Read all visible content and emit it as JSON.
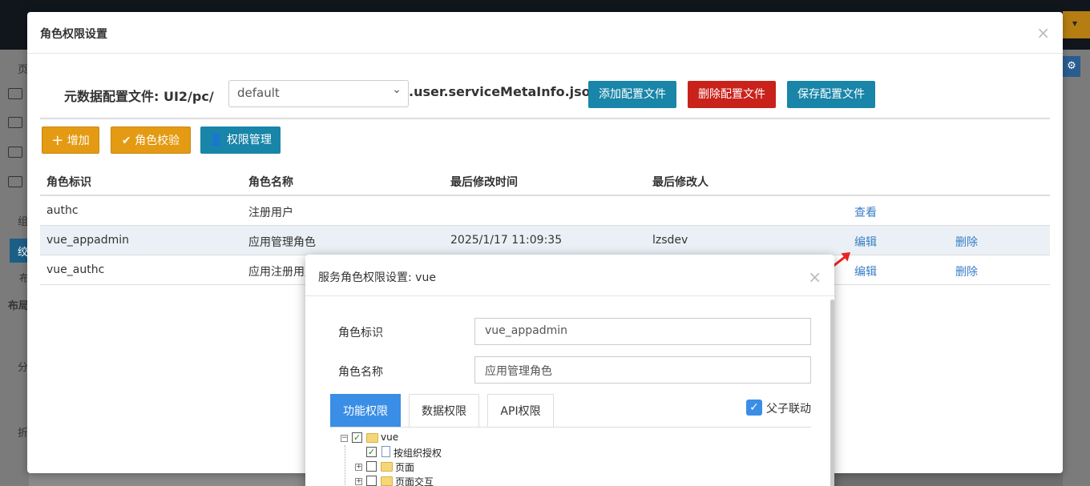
{
  "background": {
    "left_texts": [
      "页",
      "组",
      "绞",
      "布",
      "布局",
      "分",
      "折"
    ]
  },
  "dialog": {
    "title": "角色权限设置",
    "close": "×",
    "config": {
      "label": "元数据配置文件:  UI2/pc/",
      "selected": "default",
      "suffix": ".user.serviceMetaInfo.json",
      "add_btn": "添加配置文件",
      "delete_btn": "删除配置文件",
      "save_btn": "保存配置文件"
    },
    "toolbar": {
      "add": "增加",
      "check": "角色校验",
      "perm": "权限管理"
    },
    "table": {
      "headers": [
        "角色标识",
        "角色名称",
        "最后修改时间",
        "最后修改人"
      ],
      "rows": [
        {
          "id": "authc",
          "name": "注册用户",
          "time": "",
          "user": "",
          "action1": "查看",
          "action2": ""
        },
        {
          "id": "vue_appadmin",
          "name": "应用管理角色",
          "time": "2025/1/17 11:09:35",
          "user": "lzsdev",
          "action1": "编辑",
          "action2": "删除"
        },
        {
          "id": "vue_authc",
          "name": "应用注册用户",
          "time": "",
          "user": "",
          "action1": "编辑",
          "action2": "删除"
        }
      ]
    }
  },
  "subdialog": {
    "title": "服务角色权限设置:  vue",
    "close": "×",
    "role_id_label": "角色标识",
    "role_id_value": "vue_appadmin",
    "role_name_label": "角色名称",
    "role_name_value": "应用管理角色",
    "tabs": [
      "功能权限",
      "数据权限",
      "API权限"
    ],
    "link_label": "父子联动",
    "tree": {
      "root": "vue",
      "items": [
        "按组织授权",
        "页面",
        "页面交互"
      ]
    }
  },
  "colors": {
    "primary": "#1985a8",
    "danger": "#c9221b",
    "warning": "#e49a12",
    "tab_active": "#3a8ee6",
    "link": "#3a7ec6",
    "arrow": "#e22222"
  }
}
